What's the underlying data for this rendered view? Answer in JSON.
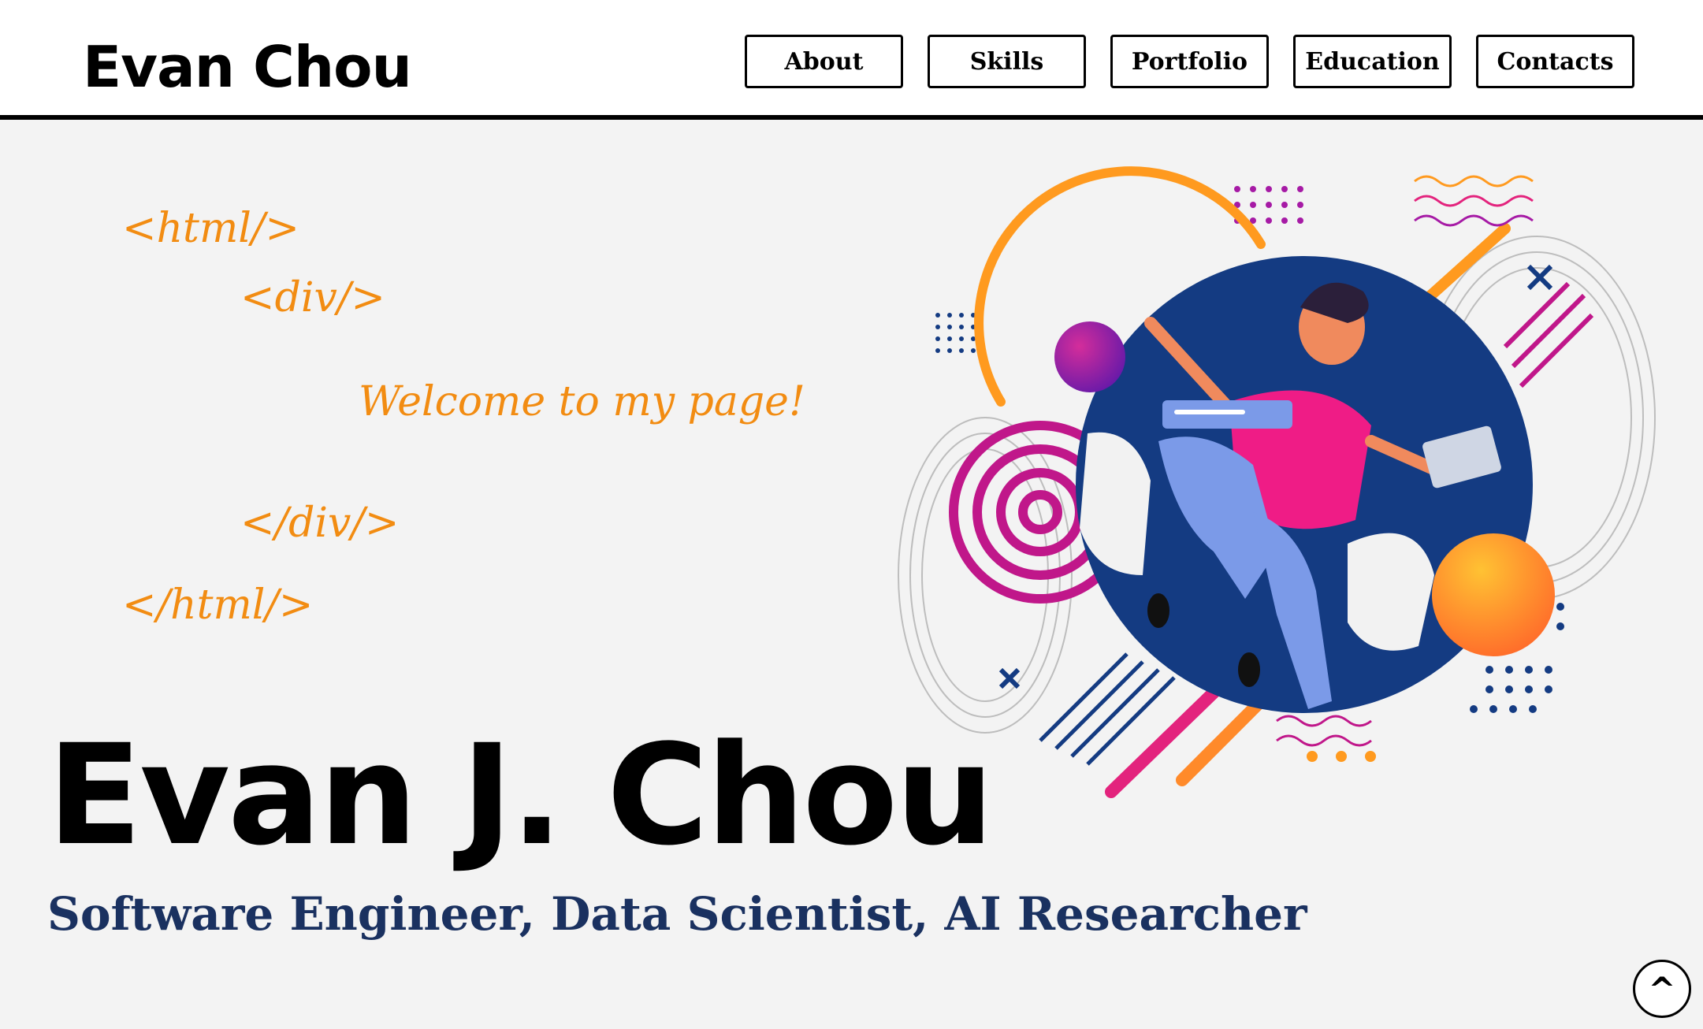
{
  "header": {
    "brand": "Evan Chou",
    "nav": [
      {
        "label": "About"
      },
      {
        "label": "Skills"
      },
      {
        "label": "Portfolio"
      },
      {
        "label": "Education"
      },
      {
        "label": "Contacts"
      }
    ]
  },
  "hero": {
    "code_lines": {
      "html_open": "<html/>",
      "div_open": "<div/>",
      "welcome": "Welcome to my page!",
      "div_close": "</div/>",
      "html_close": "</html/>"
    },
    "name": "Evan J. Chou",
    "tagline": "Software Engineer, Data Scientist, AI Researcher"
  },
  "scroll_top": {
    "label": "^"
  },
  "colors": {
    "accent_orange": "#f28c12",
    "tagline_navy": "#1a3160",
    "circle_blue": "#143b82",
    "magenta": "#c0178a",
    "shirt_pink": "#ef1c86"
  }
}
